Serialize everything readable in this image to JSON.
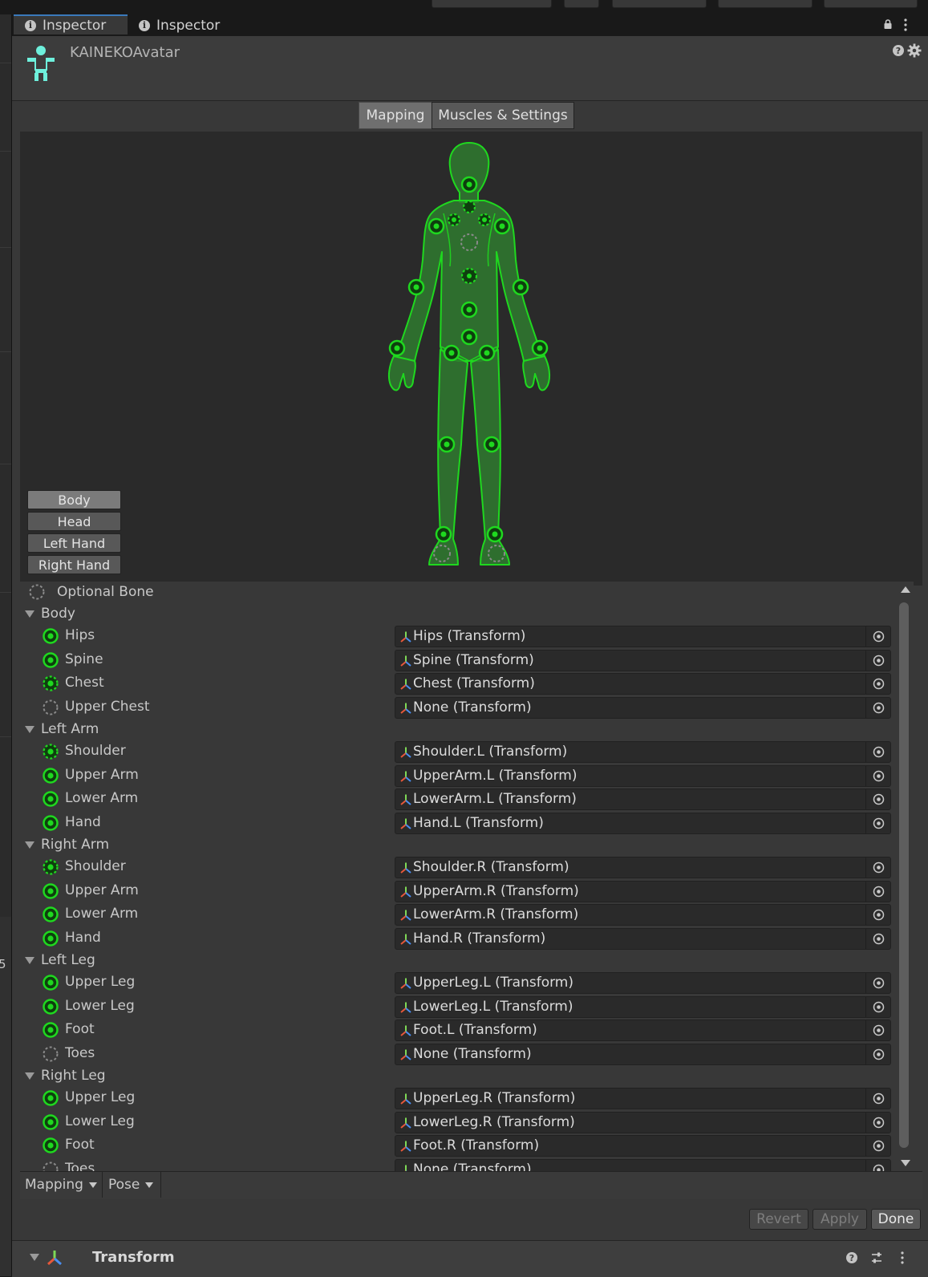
{
  "window": {
    "tabs": [
      {
        "label": "Inspector",
        "icon": "info-icon",
        "active": true
      },
      {
        "label": "Inspector",
        "icon": "info-icon",
        "active": false
      }
    ]
  },
  "asset": {
    "name": "KAINEKOAvatar",
    "icon": "avatar-icon"
  },
  "modes": {
    "mapping": "Mapping",
    "muscles": "Muscles & Settings",
    "active": "Mapping"
  },
  "body_parts": [
    "Body",
    "Head",
    "Left Hand",
    "Right Hand"
  ],
  "active_body_part": "Body",
  "legend": {
    "optional": "Optional Bone"
  },
  "groups": [
    {
      "title": "Body",
      "bones": [
        {
          "label": "Hips",
          "value": "Hips (Transform)",
          "state": "mapped"
        },
        {
          "label": "Spine",
          "value": "Spine (Transform)",
          "state": "mapped"
        },
        {
          "label": "Chest",
          "value": "Chest (Transform)",
          "state": "optional-mapped"
        },
        {
          "label": "Upper Chest",
          "value": "None (Transform)",
          "state": "optional-empty"
        }
      ]
    },
    {
      "title": "Left Arm",
      "bones": [
        {
          "label": "Shoulder",
          "value": "Shoulder.L (Transform)",
          "state": "optional-mapped"
        },
        {
          "label": "Upper Arm",
          "value": "UpperArm.L (Transform)",
          "state": "mapped"
        },
        {
          "label": "Lower Arm",
          "value": "LowerArm.L (Transform)",
          "state": "mapped"
        },
        {
          "label": "Hand",
          "value": "Hand.L (Transform)",
          "state": "mapped"
        }
      ]
    },
    {
      "title": "Right Arm",
      "bones": [
        {
          "label": "Shoulder",
          "value": "Shoulder.R (Transform)",
          "state": "optional-mapped"
        },
        {
          "label": "Upper Arm",
          "value": "UpperArm.R (Transform)",
          "state": "mapped"
        },
        {
          "label": "Lower Arm",
          "value": "LowerArm.R (Transform)",
          "state": "mapped"
        },
        {
          "label": "Hand",
          "value": "Hand.R (Transform)",
          "state": "mapped"
        }
      ]
    },
    {
      "title": "Left Leg",
      "bones": [
        {
          "label": "Upper Leg",
          "value": "UpperLeg.L (Transform)",
          "state": "mapped"
        },
        {
          "label": "Lower Leg",
          "value": "LowerLeg.L (Transform)",
          "state": "mapped"
        },
        {
          "label": "Foot",
          "value": "Foot.L (Transform)",
          "state": "mapped"
        },
        {
          "label": "Toes",
          "value": "None (Transform)",
          "state": "optional-empty"
        }
      ]
    },
    {
      "title": "Right Leg",
      "bones": [
        {
          "label": "Upper Leg",
          "value": "UpperLeg.R (Transform)",
          "state": "mapped"
        },
        {
          "label": "Lower Leg",
          "value": "LowerLeg.R (Transform)",
          "state": "mapped"
        },
        {
          "label": "Foot",
          "value": "Foot.R (Transform)",
          "state": "mapped"
        },
        {
          "label": "Toes",
          "value": "None (Transform)",
          "state": "optional-empty"
        }
      ]
    }
  ],
  "footer": {
    "mapping_menu": "Mapping",
    "pose_menu": "Pose"
  },
  "actions": {
    "revert": "Revert",
    "apply": "Apply",
    "done": "Done"
  },
  "component": {
    "title": "Transform",
    "icon": "transform-icon"
  },
  "side_panel": {
    "number": "5"
  },
  "colors": {
    "accent_tab": "#3a79bb",
    "bone_green": "#1fd81f",
    "body_fill": "#2f8a2f",
    "avatar_icon": "#6ef0dc"
  }
}
